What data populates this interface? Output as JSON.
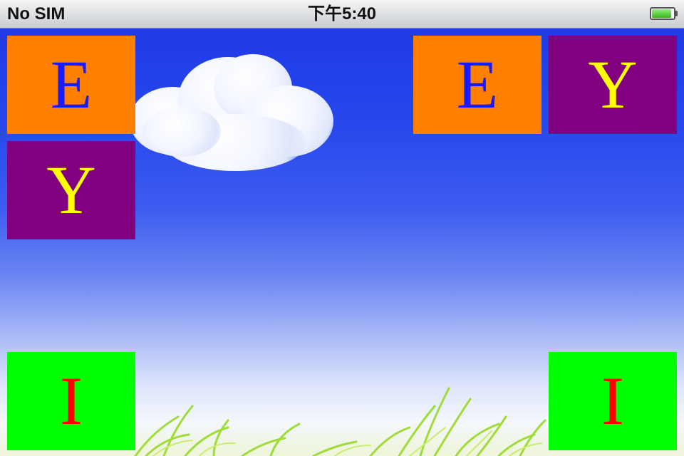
{
  "status_bar": {
    "carrier": "No SIM",
    "time": "下午5:40",
    "battery_level": 0.9,
    "battery_color": "#4cd62e"
  },
  "scene": {
    "sky_color": "#2747ec",
    "elements": [
      "cloud",
      "grass"
    ]
  },
  "tiles": [
    {
      "letter": "E",
      "background": "#ff8000",
      "color": "#1a1aff"
    },
    {
      "letter": "Y",
      "background": "#800080",
      "color": "#ffff00"
    },
    {
      "letter": "E",
      "background": "#ff8000",
      "color": "#1a1aff"
    },
    {
      "letter": "Y",
      "background": "#800080",
      "color": "#ffff00"
    },
    {
      "letter": "I",
      "background": "#00ff00",
      "color": "#ff0000"
    },
    {
      "letter": "I",
      "background": "#00ff00",
      "color": "#ff0000"
    }
  ]
}
